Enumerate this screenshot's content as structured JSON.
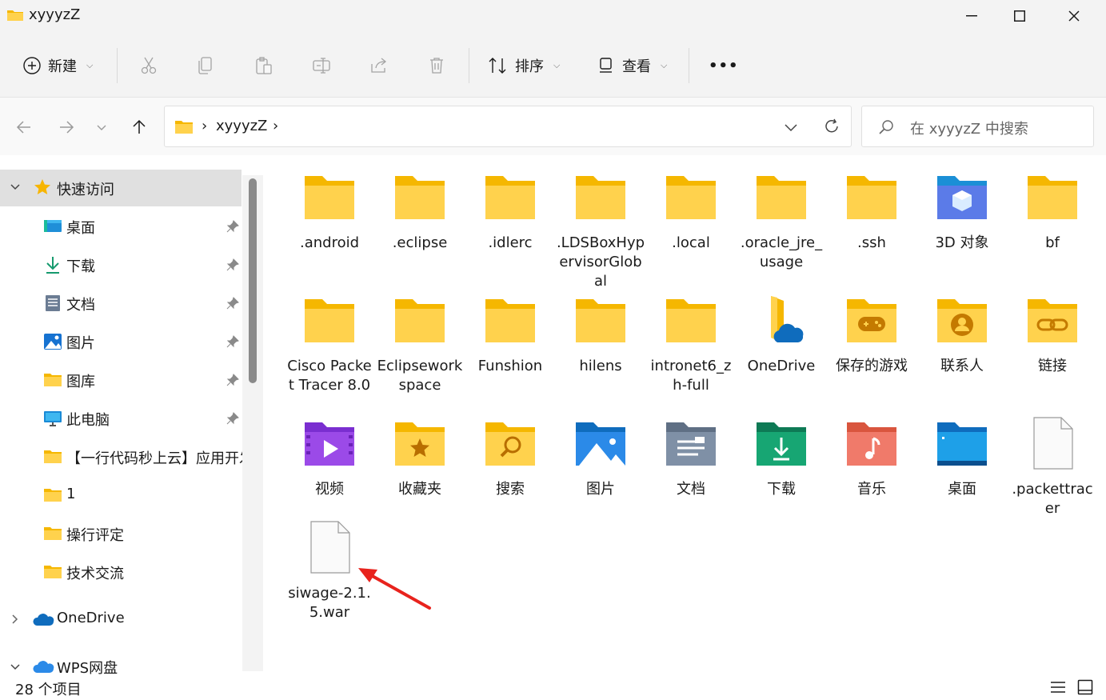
{
  "window": {
    "title": "xyyyzZ"
  },
  "toolbar": {
    "new_label": "新建",
    "sort_label": "排序",
    "view_label": "查看",
    "more_label": "•••"
  },
  "address": {
    "path": [
      "xyyyzZ"
    ],
    "search_placeholder": "在 xyyyzZ 中搜索"
  },
  "sidebar": {
    "quick_access": "快速访问",
    "items": [
      {
        "label": "桌面",
        "icon": "desktop-icon",
        "pinned": true
      },
      {
        "label": "下载",
        "icon": "download-icon",
        "pinned": true
      },
      {
        "label": "文档",
        "icon": "document-icon",
        "pinned": true
      },
      {
        "label": "图片",
        "icon": "picture-icon",
        "pinned": true
      },
      {
        "label": "图库",
        "icon": "folder-icon",
        "pinned": true
      },
      {
        "label": "此电脑",
        "icon": "computer-icon",
        "pinned": true
      },
      {
        "label": "【一行代码秒上云】应用开发",
        "icon": "folder-icon",
        "pinned": false
      },
      {
        "label": "1",
        "icon": "folder-icon",
        "pinned": false
      },
      {
        "label": "操行评定",
        "icon": "folder-icon",
        "pinned": false
      },
      {
        "label": "技术交流",
        "icon": "folder-icon",
        "pinned": false
      }
    ],
    "onedrive": "OneDrive",
    "wps": "WPS网盘"
  },
  "files": [
    {
      "name": ".android",
      "icon": "folder-icon"
    },
    {
      "name": ".eclipse",
      "icon": "folder-icon"
    },
    {
      "name": ".idlerc",
      "icon": "folder-icon"
    },
    {
      "name": ".LDSBoxHypervisorGlobal",
      "icon": "folder-icon"
    },
    {
      "name": ".local",
      "icon": "folder-icon"
    },
    {
      "name": ".oracle_jre_usage",
      "icon": "folder-icon"
    },
    {
      "name": ".ssh",
      "icon": "folder-icon"
    },
    {
      "name": "3D 对象",
      "icon": "3d-objects-folder-icon"
    },
    {
      "name": "bf",
      "icon": "folder-icon"
    },
    {
      "name": "Cisco Packet Tracer 8.0",
      "icon": "folder-icon"
    },
    {
      "name": "Eclipseworkspace",
      "icon": "folder-icon"
    },
    {
      "name": "Funshion",
      "icon": "folder-icon"
    },
    {
      "name": "hilens",
      "icon": "folder-icon"
    },
    {
      "name": "intronet6_zh-full",
      "icon": "folder-icon"
    },
    {
      "name": "OneDrive",
      "icon": "onedrive-folder-icon"
    },
    {
      "name": "保存的游戏",
      "icon": "games-folder-icon"
    },
    {
      "name": "联系人",
      "icon": "contacts-folder-icon"
    },
    {
      "name": "链接",
      "icon": "links-folder-icon"
    },
    {
      "name": "视频",
      "icon": "videos-folder-icon"
    },
    {
      "name": "收藏夹",
      "icon": "favorites-folder-icon"
    },
    {
      "name": "搜索",
      "icon": "searches-folder-icon"
    },
    {
      "name": "图片",
      "icon": "pictures-folder-icon"
    },
    {
      "name": "文档",
      "icon": "documents-folder-icon"
    },
    {
      "name": "下载",
      "icon": "downloads-folder-icon"
    },
    {
      "name": "音乐",
      "icon": "music-folder-icon"
    },
    {
      "name": "桌面",
      "icon": "desktop-folder-icon"
    },
    {
      "name": ".packettracer",
      "icon": "file-icon"
    },
    {
      "name": "siwage-2.1.5.war",
      "icon": "file-icon"
    }
  ],
  "status": {
    "count": "28 个项目"
  },
  "colors": {
    "folder_yellow": "#ffd24d",
    "selection": "#e0e0e0",
    "annotation_arrow": "#e8231d"
  }
}
